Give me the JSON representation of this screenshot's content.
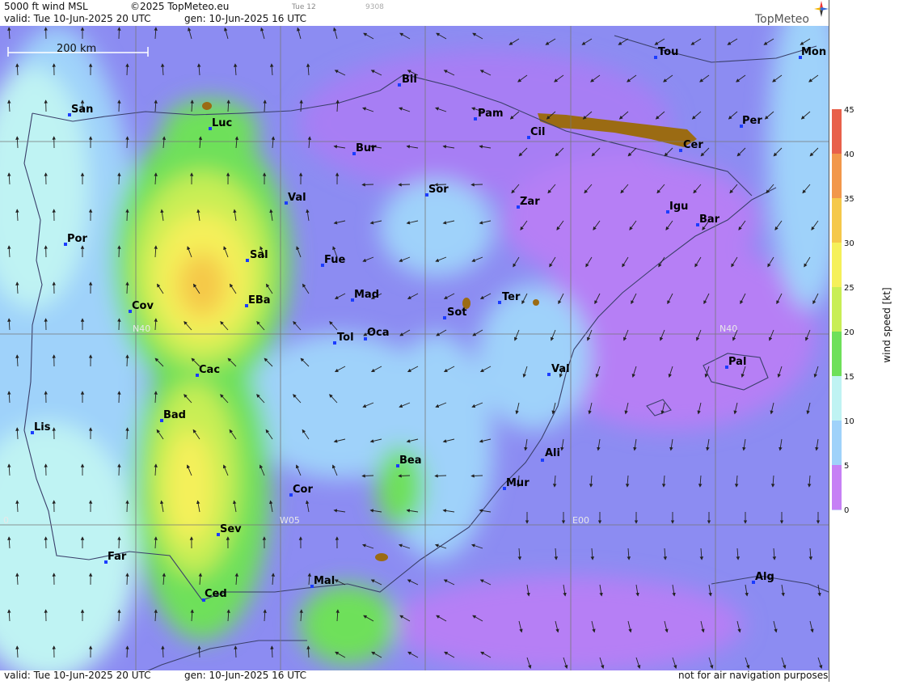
{
  "header": {
    "product": "5000 ft wind MSL",
    "copyright": "©2025 TopMeteo.eu",
    "valid": "valid:  Tue  10-Jun-2025  20 UTC",
    "gen": "gen: 10-Jun-2025 16 UTC",
    "small1": "Tue 12",
    "small2": "9308",
    "brand": "TopMeteo"
  },
  "footer": {
    "valid": "valid:  Tue  10-Jun-2025  20 UTC",
    "gen": "gen: 10-Jun-2025 16 UTC",
    "disclaimer": "not for air navigation purposes"
  },
  "map": {
    "scale_label": "200 km",
    "grid_labels": [
      "N40",
      "N40",
      "W05",
      "E00",
      "0"
    ],
    "cities": [
      "Tou",
      "Mon",
      "Bil",
      "San",
      "Luc",
      "Pam",
      "Cil",
      "Per",
      "Bur",
      "Cer",
      "Sor",
      "Val",
      "Zar",
      "Igu",
      "Bar",
      "Por",
      "Sal",
      "Fue",
      "Mad",
      "Ter",
      "Cov",
      "EBa",
      "Sot",
      "Tol",
      "Oca",
      "Pal",
      "Cac",
      "Val",
      "Bad",
      "Lis",
      "Bea",
      "Ali",
      "Cor",
      "Mur",
      "Sev",
      "Far",
      "Ced",
      "Mal",
      "Alg"
    ]
  },
  "colorbar": {
    "title": "wind speed [kt]",
    "ticks": [
      "45",
      "40",
      "35",
      "30",
      "25",
      "20",
      "15",
      "10",
      "5",
      "0"
    ],
    "colors": [
      "#e8604a",
      "#f2974a",
      "#f5c84a",
      "#f5f05a",
      "#c8ee55",
      "#6ee05a",
      "#bff3f3",
      "#9fd2fa",
      "#8c8cf2",
      "#c680f5"
    ]
  }
}
